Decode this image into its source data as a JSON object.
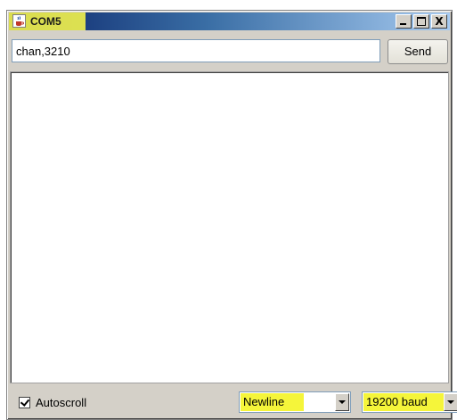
{
  "window": {
    "title": "COM5",
    "caption_buttons": {
      "minimize": "minimize-icon",
      "maximize": "maximize-icon",
      "close": "close-icon",
      "close_glyph": "X"
    },
    "app_icon": "java-cup-icon"
  },
  "input": {
    "value": "chan,3210"
  },
  "toolbar": {
    "send_label": "Send"
  },
  "output": {
    "text": ""
  },
  "footer": {
    "autoscroll_label": "Autoscroll",
    "autoscroll_checked": true,
    "line_ending": {
      "selected": "Newline"
    },
    "baud_rate": {
      "selected": "19200 baud"
    }
  },
  "colors": {
    "highlight": "#f5f53a",
    "titlebar_start": "#0a246a",
    "titlebar_end": "#a6caf0",
    "chrome": "#d4d0c8"
  }
}
